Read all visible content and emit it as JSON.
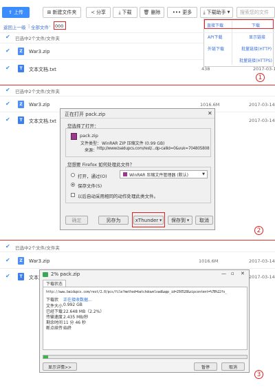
{
  "toolbar": {
    "upload": "上传",
    "new_folder": "新建文件夹",
    "share": "分享",
    "download": "下载",
    "delete": "删除",
    "more": "更多",
    "batch_download": "下载助手",
    "search_placeholder": "搜索您的文件"
  },
  "breadcrumb": {
    "back": "返回上一级",
    "all_files": "全部文件",
    "folder": "000"
  },
  "download_menu": {
    "left": [
      "直接下载",
      "API下载",
      "外链下载"
    ],
    "right": [
      "下载",
      "显示链接",
      "批量链接(HTTP)",
      "批量链接(HTTPS)"
    ]
  },
  "selection_text": "已选中2个文件/文件夹",
  "panel1": {
    "files": [
      {
        "name": "War3.zip",
        "size": "",
        "date": ""
      },
      {
        "name": "文本文档.txt",
        "size": "438",
        "date": "2017-03-1"
      }
    ],
    "step": "1"
  },
  "panel2": {
    "files": [
      {
        "name": "War3.zip",
        "size": "1016.6M",
        "date": "2017-03-14"
      },
      {
        "name": "文本文档.txt",
        "size": "438",
        "date": "2017-03-14"
      }
    ],
    "step": "2",
    "dialog": {
      "title": "正在打开 pack.zip",
      "chose_label": "您选择了打开：",
      "filename": "pack.zip",
      "type_label": "文件类型：",
      "type_value": "WinRAR ZIP 压缩文件 (0.99 GB)",
      "source_label": "来源：",
      "source_value": "http://www.baidupcs.com/rest/...dp-callid=0&vuk=704805808",
      "question": "您想要 Firefox 如何处理此文件？",
      "open_with": "打开，通过(O)",
      "open_app": "WinRAR 压缩文件管理器 (默认)",
      "save_file": "保存文件(S)",
      "auto_checkbox": "以后自动采用相同的动作处理此类文件。",
      "buttons": {
        "ok": "确定",
        "save_as": "另存为",
        "xthunder": "xThunder",
        "save_to": "保存到",
        "cancel": "取消"
      }
    }
  },
  "panel3": {
    "files": [
      {
        "name": "War3.zip",
        "size": "1016.6M",
        "date": "2017-03-14"
      },
      {
        "name": "文本文档.txt",
        "size": "",
        "date": "2017-03-14"
      }
    ],
    "step": "3",
    "progress": {
      "title": "2% pack.zip",
      "tab": "下载状态",
      "url": "http://www.baidupcs.com/rest/2.0/pcs/file?method=batchdownload&app_id=250528&zipcontent=%7B%22fs_",
      "rows": [
        {
          "label": "下载状",
          "value": "正在接收数据..."
        },
        {
          "label": "文件大小",
          "value": "0.992 GB"
        },
        {
          "label": "已经下载",
          "value": "22.648 MB（2.2%）"
        },
        {
          "label": "传输速度",
          "value": "2.435 MB/秒"
        },
        {
          "label": "剩余时间",
          "value": "11 分 46 秒"
        },
        {
          "label": "断点续传",
          "value": "始终"
        }
      ],
      "percent": 2.2,
      "details_button": "显示详情>>",
      "pause_button": "暂停",
      "cancel_button": "取消"
    }
  },
  "colors": {
    "accent": "#3b8cff",
    "annotation": "#e02020"
  }
}
